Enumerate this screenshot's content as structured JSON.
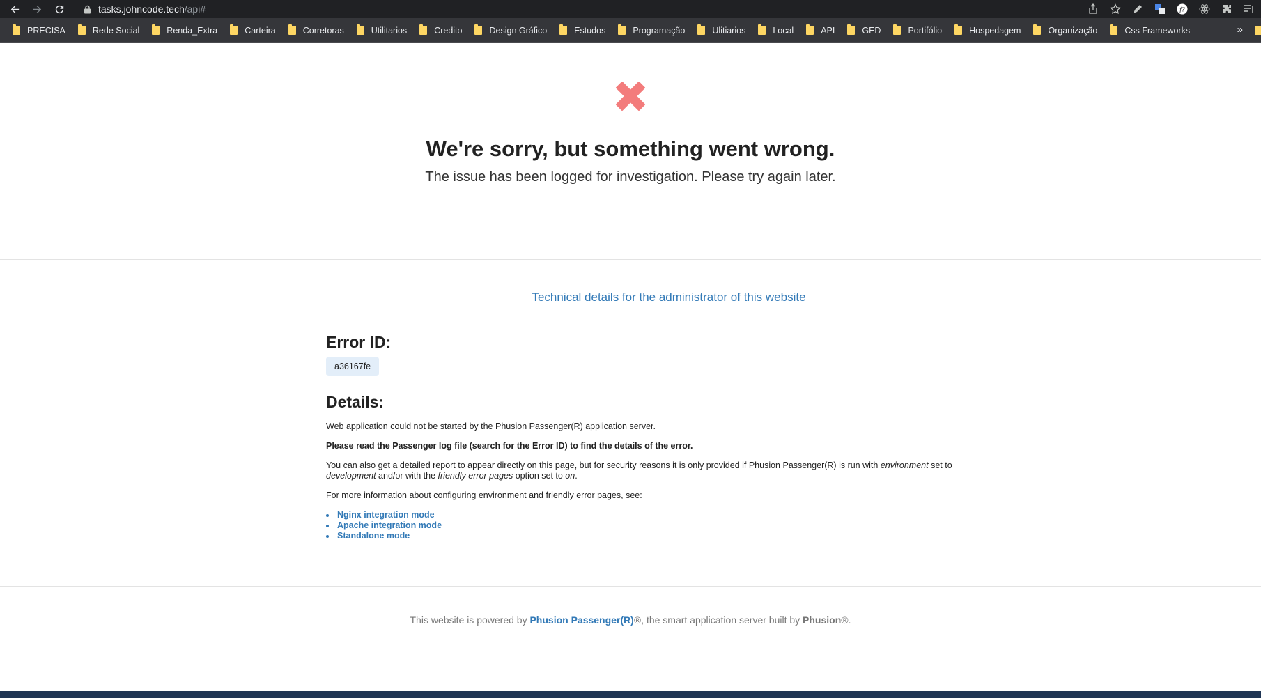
{
  "browser": {
    "url_host": "tasks.johncode.tech",
    "url_path": "/api#",
    "bookmarks": [
      "PRECISA",
      "Rede Social",
      "Renda_Extra",
      "Carteira",
      "Corretoras",
      "Utilitarios",
      "Credito",
      "Design Gráfico",
      "Estudos",
      "Programação",
      "Ulitiarios",
      "Local",
      "API",
      "GED",
      "Portifólio",
      "Hospedagem",
      "Organização",
      "Css Frameworks"
    ],
    "bookmarks_more": "»"
  },
  "error_page": {
    "title": "We're sorry, but something went wrong.",
    "subtitle": "The issue has been logged for investigation. Please try again later.",
    "tech_link": "Technical details for the administrator of this website",
    "error_id_heading": "Error ID:",
    "error_id": "a36167fe",
    "details_heading": "Details:",
    "p1": "Web application could not be started by the Phusion Passenger(R) application server.",
    "p2": "Please read the Passenger log file (search for the Error ID) to find the details of the error.",
    "p3_a": "You can also get a detailed report to appear directly on this page, but for security reasons it is only provided if Phusion Passenger(R) is run with ",
    "p3_env": "environment",
    "p3_b": " set to ",
    "p3_dev": "development",
    "p3_c": " and/or with the ",
    "p3_fep": "friendly error pages",
    "p3_d": " option set to ",
    "p3_on": "on",
    "p3_e": ".",
    "p4": "For more information about configuring environment and friendly error pages, see:",
    "links": [
      "Nginx integration mode",
      "Apache integration mode",
      "Standalone mode"
    ]
  },
  "footer": {
    "prefix": "This website is powered by ",
    "passenger": "Phusion Passenger(R)",
    "middle": "®, the smart application server built by ",
    "phusion": "Phusion",
    "suffix": "®."
  },
  "colors": {
    "x_icon": "#f37c7c",
    "link": "#337ab7",
    "error_id_bg": "#e3eef9"
  }
}
